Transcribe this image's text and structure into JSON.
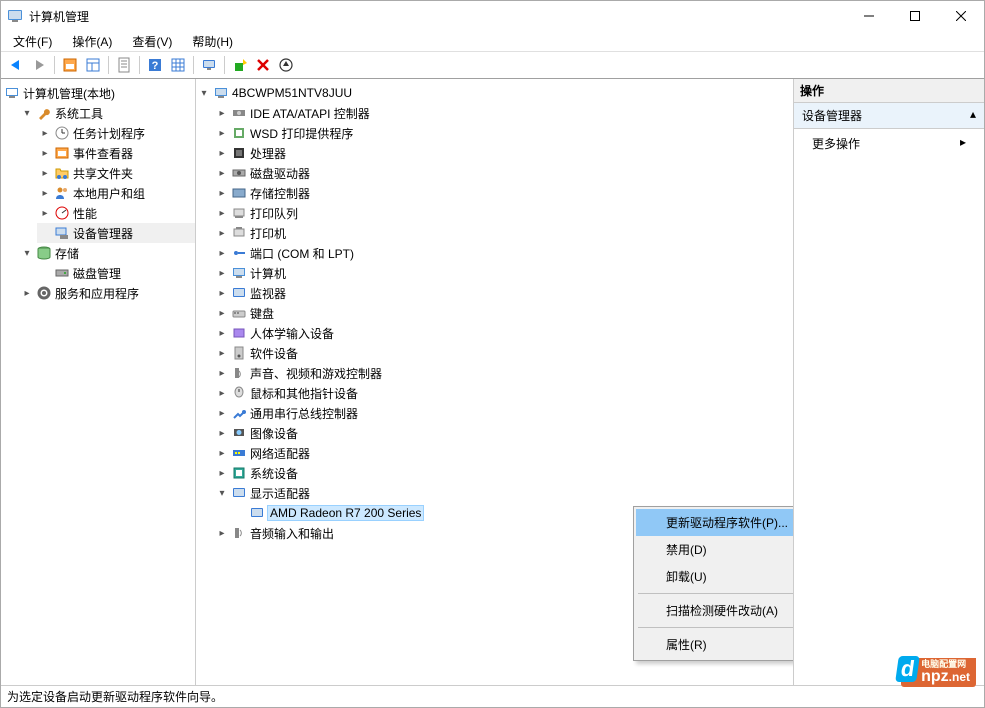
{
  "window": {
    "title": "计算机管理"
  },
  "menus": {
    "file": "文件(F)",
    "action": "操作(A)",
    "view": "查看(V)",
    "help": "帮助(H)"
  },
  "leftTree": {
    "root": "计算机管理(本地)",
    "systemTools": "系统工具",
    "taskSched": "任务计划程序",
    "eventViewer": "事件查看器",
    "sharedFolders": "共享文件夹",
    "localUsers": "本地用户和组",
    "performance": "性能",
    "deviceManager": "设备管理器",
    "storage": "存储",
    "diskMgmt": "磁盘管理",
    "servicesApps": "服务和应用程序"
  },
  "devTree": {
    "root": "4BCWPM51NTV8JUU",
    "items": [
      "IDE ATA/ATAPI 控制器",
      "WSD 打印提供程序",
      "处理器",
      "磁盘驱动器",
      "存储控制器",
      "打印队列",
      "打印机",
      "端口 (COM 和 LPT)",
      "计算机",
      "监视器",
      "键盘",
      "人体学输入设备",
      "软件设备",
      "声音、视频和游戏控制器",
      "鼠标和其他指针设备",
      "通用串行总线控制器",
      "图像设备",
      "网络适配器",
      "系统设备"
    ],
    "displayAdapters": "显示适配器",
    "displayChild": "AMD Radeon R7 200 Series",
    "audio": "音频输入和输出"
  },
  "contextMenu": {
    "update": "更新驱动程序软件(P)...",
    "disable": "禁用(D)",
    "uninstall": "卸载(U)",
    "scan": "扫描检测硬件改动(A)",
    "properties": "属性(R)"
  },
  "actions": {
    "header": "操作",
    "deviceMgr": "设备管理器",
    "more": "更多操作"
  },
  "status": "为选定设备启动更新驱动程序软件向导。",
  "brand": {
    "main": "npz",
    "sub": "电脑配置网",
    "net": ".net"
  }
}
